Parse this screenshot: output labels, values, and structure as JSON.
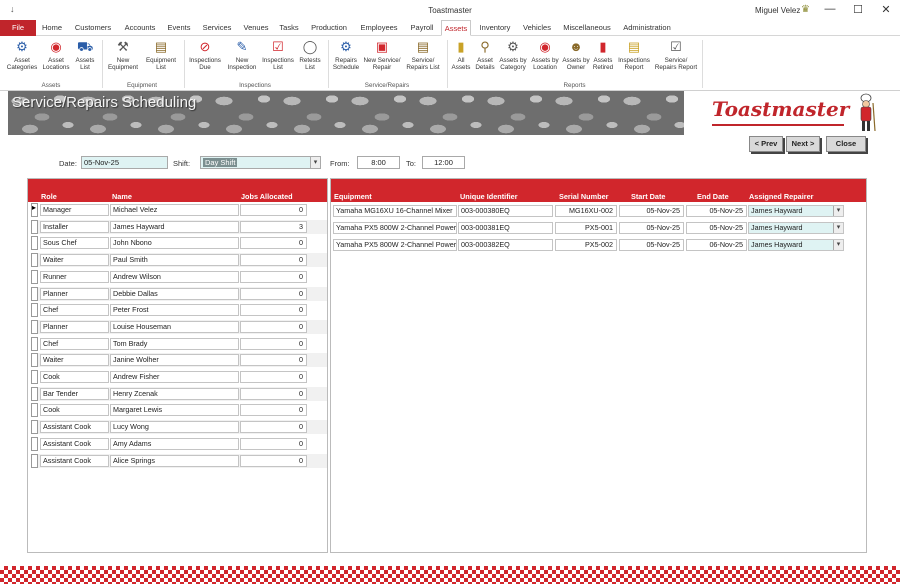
{
  "window": {
    "title": "Toastmaster",
    "user": "Miguel Velez",
    "minimize": "—",
    "maximize": "☐",
    "close": "✕",
    "quick_access": "↓"
  },
  "tabs": [
    "File",
    "Home",
    "Customers",
    "Accounts",
    "Events",
    "Services",
    "Venues",
    "Tasks",
    "Production",
    "Employees",
    "Payroll",
    "Assets",
    "Inventory",
    "Vehicles",
    "Miscellaneous",
    "Administration"
  ],
  "active_tab": "Assets",
  "ribbon": {
    "assets": [
      {
        "label1": "Asset",
        "label2": "Categories",
        "icon": "gear-icon"
      },
      {
        "label1": "Asset",
        "label2": "Locations",
        "icon": "location-pin-icon"
      },
      {
        "label1": "Assets",
        "label2": "List",
        "icon": "vehicle-list-icon"
      }
    ],
    "equipment": [
      {
        "label1": "New",
        "label2": "Equipment",
        "icon": "tools-icon"
      },
      {
        "label1": "Equipment",
        "label2": "List",
        "icon": "equipment-list-icon"
      }
    ],
    "inspections": [
      {
        "label1": "Inspections",
        "label2": "Due",
        "icon": "no-entry-icon"
      },
      {
        "label1": "New",
        "label2": "Inspection",
        "icon": "pencil-icon"
      },
      {
        "label1": "Inspections",
        "label2": "List",
        "icon": "clipboard-check-icon"
      },
      {
        "label1": "Retests",
        "label2": "List",
        "icon": "retest-icon"
      }
    ],
    "service_repairs": [
      {
        "label1": "Repairs",
        "label2": "Schedule",
        "icon": "schedule-icon"
      },
      {
        "label1": "New Service/",
        "label2": "Repair",
        "icon": "toolbox-icon"
      },
      {
        "label1": "Service/",
        "label2": "Repairs List",
        "icon": "notepad-icon"
      }
    ],
    "reports": [
      {
        "label1": "All",
        "label2": "Assets",
        "icon": "report-icon"
      },
      {
        "label1": "Asset",
        "label2": "Details",
        "icon": "magnifier-report-icon"
      },
      {
        "label1": "Assets by",
        "label2": "Category",
        "icon": "gear-report-icon"
      },
      {
        "label1": "Assets by",
        "label2": "Location",
        "icon": "pin-report-icon"
      },
      {
        "label1": "Assets by",
        "label2": "Owner",
        "icon": "owner-report-icon"
      },
      {
        "label1": "Assets",
        "label2": "Retired",
        "icon": "retired-report-icon"
      },
      {
        "label1": "Inspections",
        "label2": "Report",
        "icon": "inspection-report-icon"
      },
      {
        "label1": "Service/",
        "label2": "Repairs Report",
        "icon": "clipboard-report-icon"
      }
    ],
    "group_labels": {
      "assets": "Assets",
      "equipment": "Equipment",
      "inspections": "Inspections",
      "service_repairs": "Service/Repairs",
      "reports": "Reports"
    }
  },
  "banner": {
    "title": "Service/Repairs Scheduling",
    "logo": "Toastmaster"
  },
  "nav": {
    "prev": "< Prev",
    "next": "Next >",
    "close": "Close"
  },
  "filters": {
    "date_label": "Date:",
    "date_value": "05-Nov-25",
    "shift_label": "Shift:",
    "shift_value": "Day Shift",
    "from_label": "From:",
    "from_value": "8:00",
    "to_label": "To:",
    "to_value": "12:00"
  },
  "staff": {
    "headers": {
      "role": "Role",
      "name": "Name",
      "jobs": "Jobs Allocated"
    },
    "rows": [
      {
        "role": "Manager",
        "name": "Michael Velez",
        "jobs": "0"
      },
      {
        "role": "Installer",
        "name": "James Hayward",
        "jobs": "3"
      },
      {
        "role": "Sous Chef",
        "name": "John Nbono",
        "jobs": "0"
      },
      {
        "role": "Waiter",
        "name": "Paul Smith",
        "jobs": "0"
      },
      {
        "role": "Runner",
        "name": "Andrew Wilson",
        "jobs": "0"
      },
      {
        "role": "Planner",
        "name": "Debbie Dallas",
        "jobs": "0"
      },
      {
        "role": "Chef",
        "name": "Peter Frost",
        "jobs": "0"
      },
      {
        "role": "Planner",
        "name": "Louise Houseman",
        "jobs": "0"
      },
      {
        "role": "Chef",
        "name": "Tom Brady",
        "jobs": "0"
      },
      {
        "role": "Waiter",
        "name": "Janine Wolher",
        "jobs": "0"
      },
      {
        "role": "Cook",
        "name": "Andrew Fisher",
        "jobs": "0"
      },
      {
        "role": "Bar Tender",
        "name": "Henry Zcenak",
        "jobs": "0"
      },
      {
        "role": "Cook",
        "name": "Margaret Lewis",
        "jobs": "0"
      },
      {
        "role": "Assistant Cook",
        "name": "Lucy Wong",
        "jobs": "0"
      },
      {
        "role": "Assistant Cook",
        "name": "Amy Adams",
        "jobs": "0"
      },
      {
        "role": "Assistant Cook",
        "name": "Alice Springs",
        "jobs": "0"
      }
    ]
  },
  "jobs": {
    "headers": {
      "equipment": "Equipment",
      "uid": "Unique Identifier",
      "serial": "Serial Number",
      "start": "Start Date",
      "end": "End Date",
      "repairer": "Assigned Repairer"
    },
    "rows": [
      {
        "equipment": "Yamaha MG16XU 16-Channel Mixer",
        "uid": "003-000380EQ",
        "serial": "MG16XU-002",
        "start": "05-Nov-25",
        "end": "05-Nov-25",
        "repairer": "James Hayward"
      },
      {
        "equipment": "Yamaha PX5 800W 2-Channel Power",
        "uid": "003-000381EQ",
        "serial": "PX5-001",
        "start": "05-Nov-25",
        "end": "05-Nov-25",
        "repairer": "James Hayward"
      },
      {
        "equipment": "Yamaha PX5 800W 2-Channel Power",
        "uid": "003-000382EQ",
        "serial": "PX5-002",
        "start": "05-Nov-25",
        "end": "06-Nov-25",
        "repairer": "James Hayward"
      }
    ]
  },
  "colors": {
    "accent": "#d1262c",
    "file_tab": "#c0252b",
    "input_bg": "#dff3f3"
  }
}
